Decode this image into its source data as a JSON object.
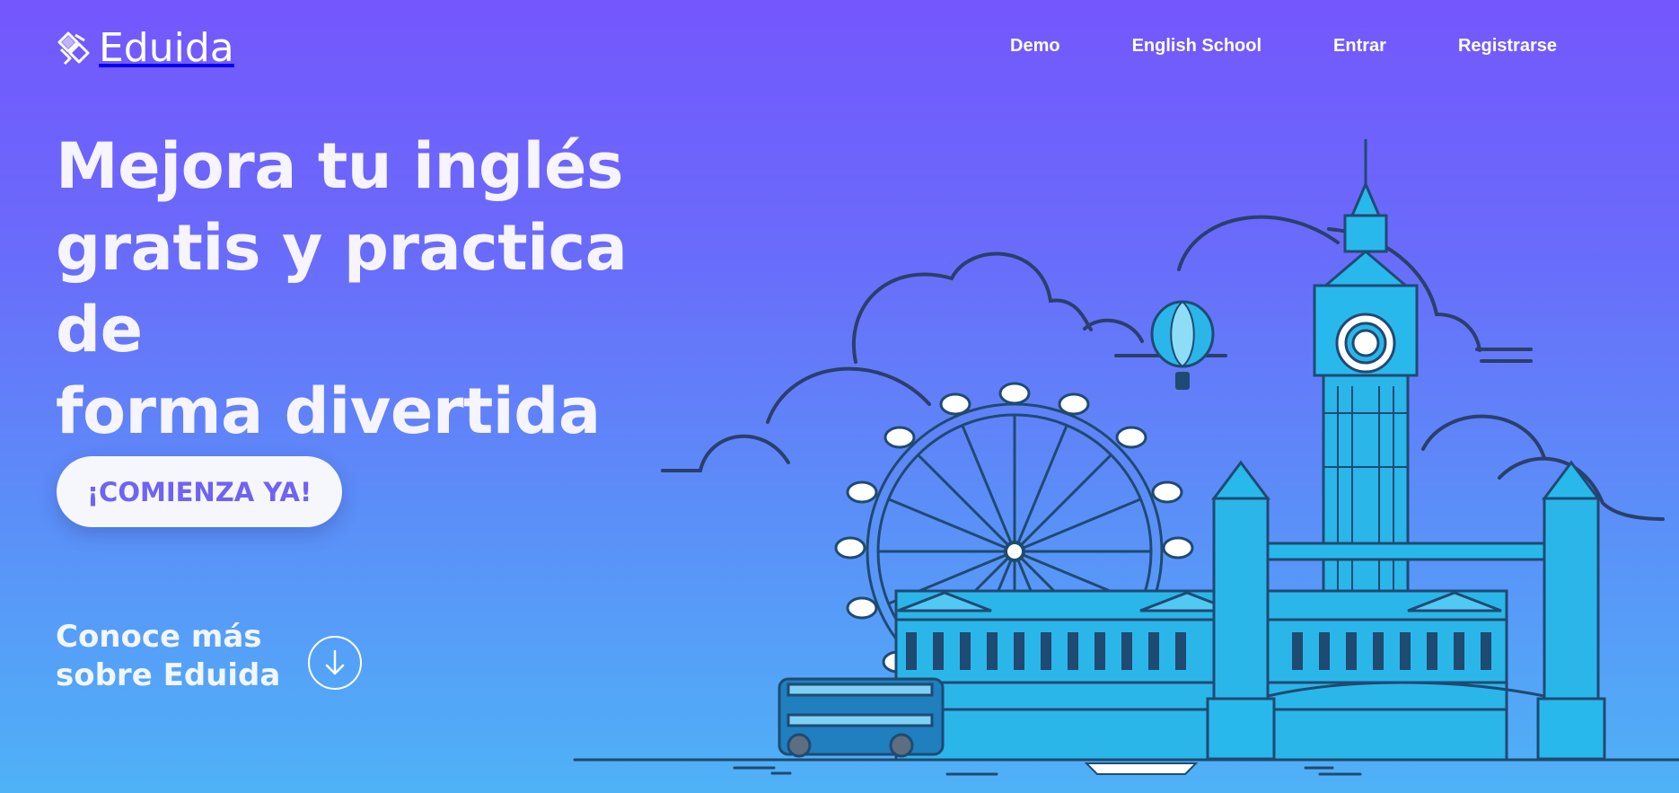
{
  "brand": {
    "name": "Eduida"
  },
  "nav": {
    "items": [
      {
        "label": "Demo"
      },
      {
        "label": "English School"
      },
      {
        "label": "Entrar"
      },
      {
        "label": "Registrarse"
      }
    ]
  },
  "hero": {
    "title_line1": "Mejora tu inglés",
    "title_line2": "gratis y practica de",
    "title_line3": "forma divertida",
    "cta_label": "¡COMIENZA YA!",
    "learn_more_line1": "Conoce más",
    "learn_more_line2": "sobre Eduida"
  },
  "colors": {
    "gradient_top": "#7457fd",
    "gradient_bottom": "#4fb2f7",
    "cta_text": "#6f63f3",
    "illustration_line": "#1f4a72",
    "illustration_fill": "#29b8ec"
  },
  "icons": {
    "logo": "eduida-logo-icon",
    "learn_more": "arrow-down-icon"
  }
}
